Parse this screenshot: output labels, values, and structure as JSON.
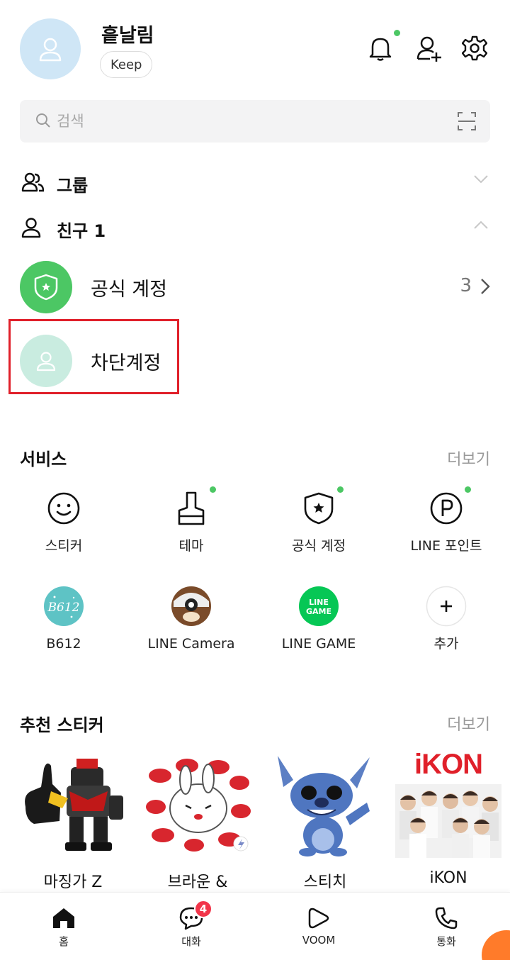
{
  "header": {
    "profile_name": "흩날림",
    "keep_label": "Keep"
  },
  "search": {
    "placeholder": "검색"
  },
  "sections": {
    "groups_label": "그룹",
    "friends_label": "친구 1"
  },
  "friends": [
    {
      "name": "공식 계정",
      "count": "3"
    },
    {
      "name": "차단계정"
    }
  ],
  "services": {
    "title": "서비스",
    "more": "더보기",
    "items": [
      {
        "label": "스티커",
        "icon": "smile-icon"
      },
      {
        "label": "테마",
        "icon": "brush-icon"
      },
      {
        "label": "공식 계정",
        "icon": "shield-star-icon"
      },
      {
        "label": "LINE 포인트",
        "icon": "points-icon"
      },
      {
        "label": "B612",
        "icon": "b612-app-icon"
      },
      {
        "label": "LINE Camera",
        "icon": "line-camera-app-icon"
      },
      {
        "label": "LINE GAME",
        "icon": "line-game-app-icon"
      },
      {
        "label": "추가",
        "icon": "plus-icon"
      }
    ]
  },
  "stickers": {
    "title": "추천 스티커",
    "more": "더보기",
    "items": [
      {
        "label": "마징가 Z"
      },
      {
        "label": "브라운 &"
      },
      {
        "label": "스티치"
      },
      {
        "label": "iKON"
      }
    ],
    "ikon_logo": "iKON"
  },
  "bottom_nav": {
    "items": [
      {
        "label": "홈"
      },
      {
        "label": "대화",
        "badge": "4"
      },
      {
        "label": "VOOM"
      },
      {
        "label": "통화"
      }
    ]
  },
  "colors": {
    "accent_green": "#4cc764",
    "badge_red": "#f2354a",
    "highlight_red": "#e0202a"
  }
}
